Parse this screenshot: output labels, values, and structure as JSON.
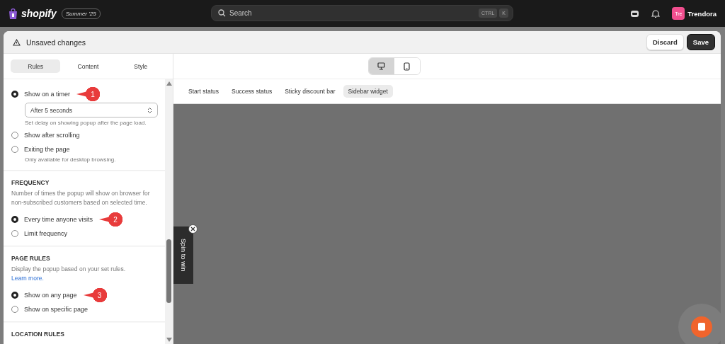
{
  "topbar": {
    "brand": "shopify",
    "edition": "Summer '25",
    "search": {
      "placeholder": "Search"
    },
    "shortcut": [
      "CTRL",
      "K"
    ],
    "store": {
      "avatar": "Tre",
      "name": "Trendora"
    }
  },
  "header": {
    "title": "Unsaved changes",
    "buttons": [
      {
        "label": "Discard",
        "kind": "secondary"
      },
      {
        "label": "Save",
        "kind": "primary"
      }
    ]
  },
  "panel_tabs": [
    {
      "label": "Rules",
      "selected": true
    },
    {
      "label": "Content",
      "selected": false
    },
    {
      "label": "Style",
      "selected": false
    }
  ],
  "sections": [
    {
      "options": [
        {
          "label": "Show on a timer",
          "selected": true,
          "callout": "1",
          "select": "After 5 seconds",
          "hint": "Set delay on showing popup after the page load."
        },
        {
          "label": "Show after scrolling",
          "selected": false
        },
        {
          "label": "Exiting the page",
          "selected": false,
          "hint": "Only available for desktop browsing."
        }
      ]
    },
    {
      "title": "FREQUENCY",
      "description": "Number of times the popup will show on browser for non-subscribed customers based on selected time.",
      "options": [
        {
          "label": "Every time anyone visits",
          "selected": true,
          "callout": "2"
        },
        {
          "label": "Limit frequency",
          "selected": false
        }
      ]
    },
    {
      "title": "PAGE RULES",
      "description": "Display the popup based on your set rules.",
      "link": "Learn more.",
      "options": [
        {
          "label": "Show on any page",
          "selected": true,
          "callout": "3"
        },
        {
          "label": "Show on specific page",
          "selected": false
        }
      ]
    },
    {
      "title": "LOCATION RULES"
    }
  ],
  "devices": [
    {
      "kind": "desktop",
      "selected": true
    },
    {
      "kind": "mobile",
      "selected": false
    }
  ],
  "preview_tabs": [
    {
      "label": "Start status",
      "selected": false
    },
    {
      "label": "Success status",
      "selected": false
    },
    {
      "label": "Sticky discount bar",
      "selected": false
    },
    {
      "label": "Sidebar widget",
      "selected": true
    }
  ],
  "widget": {
    "label": "Spin to win"
  }
}
